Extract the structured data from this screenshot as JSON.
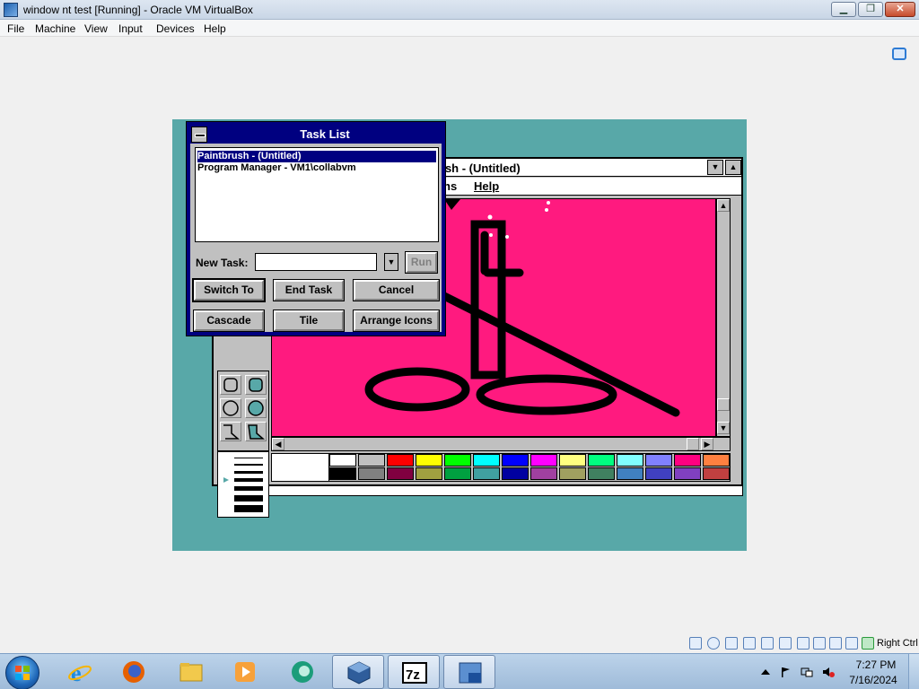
{
  "host": {
    "title": "window nt test [Running] - Oracle VM VirtualBox",
    "menu": [
      "File",
      "Machine",
      "View",
      "Input",
      "Devices",
      "Help"
    ],
    "host_key_label": "Right Ctrl"
  },
  "paintbrush": {
    "title": "ush - (Untitled)",
    "menu_partial": "ns",
    "menu_help": "Help",
    "canvas_color": "#ff1a7f",
    "palette_top": [
      "#ffffff",
      "#c0c0c0",
      "#ff0000",
      "#ffff00",
      "#00ff00",
      "#00ffff",
      "#0000ff",
      "#ff00ff",
      "#ffff80",
      "#00ff80",
      "#80ffff",
      "#8080ff",
      "#ff0080",
      "#ff8040"
    ],
    "palette_bottom": [
      "#000000",
      "#808080",
      "#800040",
      "#a0a040",
      "#00a040",
      "#40a0a0",
      "#0000a0",
      "#a040a0",
      "#a0a060",
      "#408060",
      "#4080c0",
      "#4040c0",
      "#8040c0",
      "#c04040"
    ]
  },
  "tasklist": {
    "title": "Task List",
    "items": [
      "Paintbrush - (Untitled)",
      "Program Manager - VM1\\collabvm"
    ],
    "new_task_label": "New Task:",
    "new_task_value": "",
    "buttons": {
      "run": "Run",
      "switch_to": "Switch To",
      "end_task": "End Task",
      "cancel": "Cancel",
      "cascade": "Cascade",
      "tile": "Tile",
      "arrange_icons": "Arrange Icons"
    }
  },
  "taskbar": {
    "apps": [
      "internet-explorer",
      "firefox",
      "file-explorer",
      "media-player",
      "collabvm",
      "virtualbox",
      "7zip",
      "virtualbox-vm-window"
    ],
    "time": "7:27 PM",
    "date": "7/16/2024"
  }
}
